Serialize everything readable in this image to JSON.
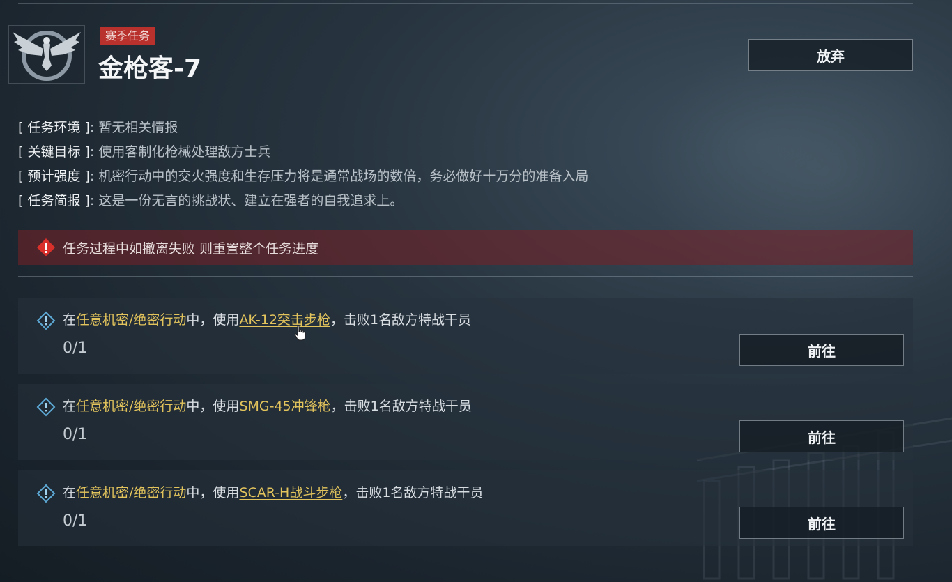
{
  "mission": {
    "tag": "赛季任务",
    "title": "金枪客-7",
    "abandon_label": "放弃"
  },
  "info": [
    {
      "key": "[ 任务环境 ]",
      "value": "暂无相关情报"
    },
    {
      "key": "[ 关键目标 ]",
      "value": "使用客制化枪械处理敌方士兵"
    },
    {
      "key": "[ 预计强度 ]",
      "value": "机密行动中的交火强度和生存压力将是通常战场的数倍，务必做好十万分的准备入局"
    },
    {
      "key": "[ 任务简报 ]",
      "value": "这是一份无言的挑战状、建立在强者的自我追求上。"
    }
  ],
  "warning": {
    "text": "任务过程中如撤离失败 则重置整个任务进度",
    "icon": "warning-icon",
    "color": "#b8312d"
  },
  "tasks": [
    {
      "prefix": "在",
      "mode": "任意机密/绝密行动",
      "middle": "中，使用",
      "weapon": "AK-12突击步枪",
      "suffix": "，击败1名敌方特战干员",
      "progress": "0/1",
      "go_label": "前往"
    },
    {
      "prefix": "在",
      "mode": "任意机密/绝密行动",
      "middle": "中，使用",
      "weapon": "SMG-45冲锋枪",
      "suffix": "，击败1名敌方特战干员",
      "progress": "0/1",
      "go_label": "前往"
    },
    {
      "prefix": "在",
      "mode": "任意机密/绝密行动",
      "middle": "中，使用",
      "weapon": "SCAR-H战斗步枪",
      "suffix": "，击败1名敌方特战干员",
      "progress": "0/1",
      "go_label": "前往"
    }
  ],
  "colors": {
    "accent_gold": "#e2c35c",
    "tag_red": "#b8312d",
    "info_blue": "#5da9d6"
  }
}
